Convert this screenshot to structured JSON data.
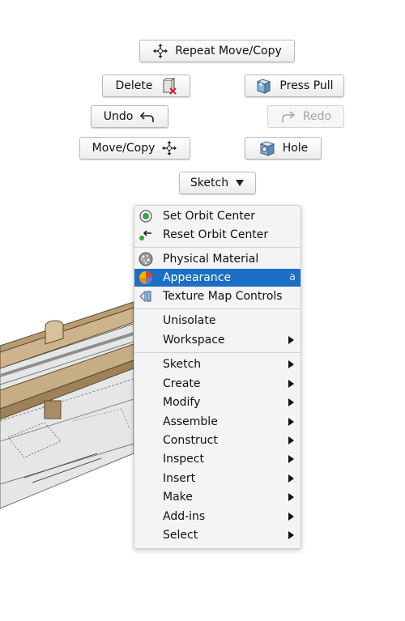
{
  "marking_menu": {
    "repeat_move_copy": "Repeat Move/Copy",
    "delete": "Delete",
    "press_pull": "Press Pull",
    "undo": "Undo",
    "redo": "Redo",
    "move_copy": "Move/Copy",
    "hole": "Hole",
    "sketch": "Sketch"
  },
  "context_menu": {
    "set_orbit_center": "Set Orbit Center",
    "reset_orbit_center": "Reset Orbit Center",
    "physical_material": "Physical Material",
    "appearance": "Appearance",
    "appearance_shortcut": "a",
    "texture_map_controls": "Texture Map Controls",
    "unisolate": "Unisolate",
    "workspace": "Workspace",
    "sketch": "Sketch",
    "create": "Create",
    "modify": "Modify",
    "assemble": "Assemble",
    "construct": "Construct",
    "inspect": "Inspect",
    "insert": "Insert",
    "make": "Make",
    "add_ins": "Add-ins",
    "select": "Select"
  },
  "colors": {
    "highlight": "#1b6fc4",
    "wood": "#c8b08a"
  }
}
